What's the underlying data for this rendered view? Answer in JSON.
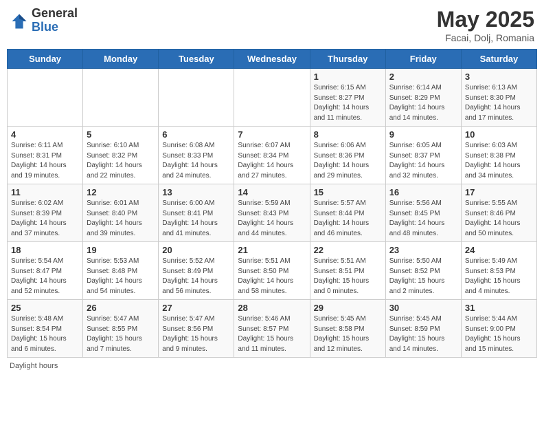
{
  "header": {
    "logo_general": "General",
    "logo_blue": "Blue",
    "month_year": "May 2025",
    "location": "Facai, Dolj, Romania"
  },
  "days_of_week": [
    "Sunday",
    "Monday",
    "Tuesday",
    "Wednesday",
    "Thursday",
    "Friday",
    "Saturday"
  ],
  "weeks": [
    [
      {
        "day": "",
        "info": ""
      },
      {
        "day": "",
        "info": ""
      },
      {
        "day": "",
        "info": ""
      },
      {
        "day": "",
        "info": ""
      },
      {
        "day": "1",
        "info": "Sunrise: 6:15 AM\nSunset: 8:27 PM\nDaylight: 14 hours\nand 11 minutes."
      },
      {
        "day": "2",
        "info": "Sunrise: 6:14 AM\nSunset: 8:29 PM\nDaylight: 14 hours\nand 14 minutes."
      },
      {
        "day": "3",
        "info": "Sunrise: 6:13 AM\nSunset: 8:30 PM\nDaylight: 14 hours\nand 17 minutes."
      }
    ],
    [
      {
        "day": "4",
        "info": "Sunrise: 6:11 AM\nSunset: 8:31 PM\nDaylight: 14 hours\nand 19 minutes."
      },
      {
        "day": "5",
        "info": "Sunrise: 6:10 AM\nSunset: 8:32 PM\nDaylight: 14 hours\nand 22 minutes."
      },
      {
        "day": "6",
        "info": "Sunrise: 6:08 AM\nSunset: 8:33 PM\nDaylight: 14 hours\nand 24 minutes."
      },
      {
        "day": "7",
        "info": "Sunrise: 6:07 AM\nSunset: 8:34 PM\nDaylight: 14 hours\nand 27 minutes."
      },
      {
        "day": "8",
        "info": "Sunrise: 6:06 AM\nSunset: 8:36 PM\nDaylight: 14 hours\nand 29 minutes."
      },
      {
        "day": "9",
        "info": "Sunrise: 6:05 AM\nSunset: 8:37 PM\nDaylight: 14 hours\nand 32 minutes."
      },
      {
        "day": "10",
        "info": "Sunrise: 6:03 AM\nSunset: 8:38 PM\nDaylight: 14 hours\nand 34 minutes."
      }
    ],
    [
      {
        "day": "11",
        "info": "Sunrise: 6:02 AM\nSunset: 8:39 PM\nDaylight: 14 hours\nand 37 minutes."
      },
      {
        "day": "12",
        "info": "Sunrise: 6:01 AM\nSunset: 8:40 PM\nDaylight: 14 hours\nand 39 minutes."
      },
      {
        "day": "13",
        "info": "Sunrise: 6:00 AM\nSunset: 8:41 PM\nDaylight: 14 hours\nand 41 minutes."
      },
      {
        "day": "14",
        "info": "Sunrise: 5:59 AM\nSunset: 8:43 PM\nDaylight: 14 hours\nand 44 minutes."
      },
      {
        "day": "15",
        "info": "Sunrise: 5:57 AM\nSunset: 8:44 PM\nDaylight: 14 hours\nand 46 minutes."
      },
      {
        "day": "16",
        "info": "Sunrise: 5:56 AM\nSunset: 8:45 PM\nDaylight: 14 hours\nand 48 minutes."
      },
      {
        "day": "17",
        "info": "Sunrise: 5:55 AM\nSunset: 8:46 PM\nDaylight: 14 hours\nand 50 minutes."
      }
    ],
    [
      {
        "day": "18",
        "info": "Sunrise: 5:54 AM\nSunset: 8:47 PM\nDaylight: 14 hours\nand 52 minutes."
      },
      {
        "day": "19",
        "info": "Sunrise: 5:53 AM\nSunset: 8:48 PM\nDaylight: 14 hours\nand 54 minutes."
      },
      {
        "day": "20",
        "info": "Sunrise: 5:52 AM\nSunset: 8:49 PM\nDaylight: 14 hours\nand 56 minutes."
      },
      {
        "day": "21",
        "info": "Sunrise: 5:51 AM\nSunset: 8:50 PM\nDaylight: 14 hours\nand 58 minutes."
      },
      {
        "day": "22",
        "info": "Sunrise: 5:51 AM\nSunset: 8:51 PM\nDaylight: 15 hours\nand 0 minutes."
      },
      {
        "day": "23",
        "info": "Sunrise: 5:50 AM\nSunset: 8:52 PM\nDaylight: 15 hours\nand 2 minutes."
      },
      {
        "day": "24",
        "info": "Sunrise: 5:49 AM\nSunset: 8:53 PM\nDaylight: 15 hours\nand 4 minutes."
      }
    ],
    [
      {
        "day": "25",
        "info": "Sunrise: 5:48 AM\nSunset: 8:54 PM\nDaylight: 15 hours\nand 6 minutes."
      },
      {
        "day": "26",
        "info": "Sunrise: 5:47 AM\nSunset: 8:55 PM\nDaylight: 15 hours\nand 7 minutes."
      },
      {
        "day": "27",
        "info": "Sunrise: 5:47 AM\nSunset: 8:56 PM\nDaylight: 15 hours\nand 9 minutes."
      },
      {
        "day": "28",
        "info": "Sunrise: 5:46 AM\nSunset: 8:57 PM\nDaylight: 15 hours\nand 11 minutes."
      },
      {
        "day": "29",
        "info": "Sunrise: 5:45 AM\nSunset: 8:58 PM\nDaylight: 15 hours\nand 12 minutes."
      },
      {
        "day": "30",
        "info": "Sunrise: 5:45 AM\nSunset: 8:59 PM\nDaylight: 15 hours\nand 14 minutes."
      },
      {
        "day": "31",
        "info": "Sunrise: 5:44 AM\nSunset: 9:00 PM\nDaylight: 15 hours\nand 15 minutes."
      }
    ]
  ],
  "footer": {
    "note": "Daylight hours"
  }
}
